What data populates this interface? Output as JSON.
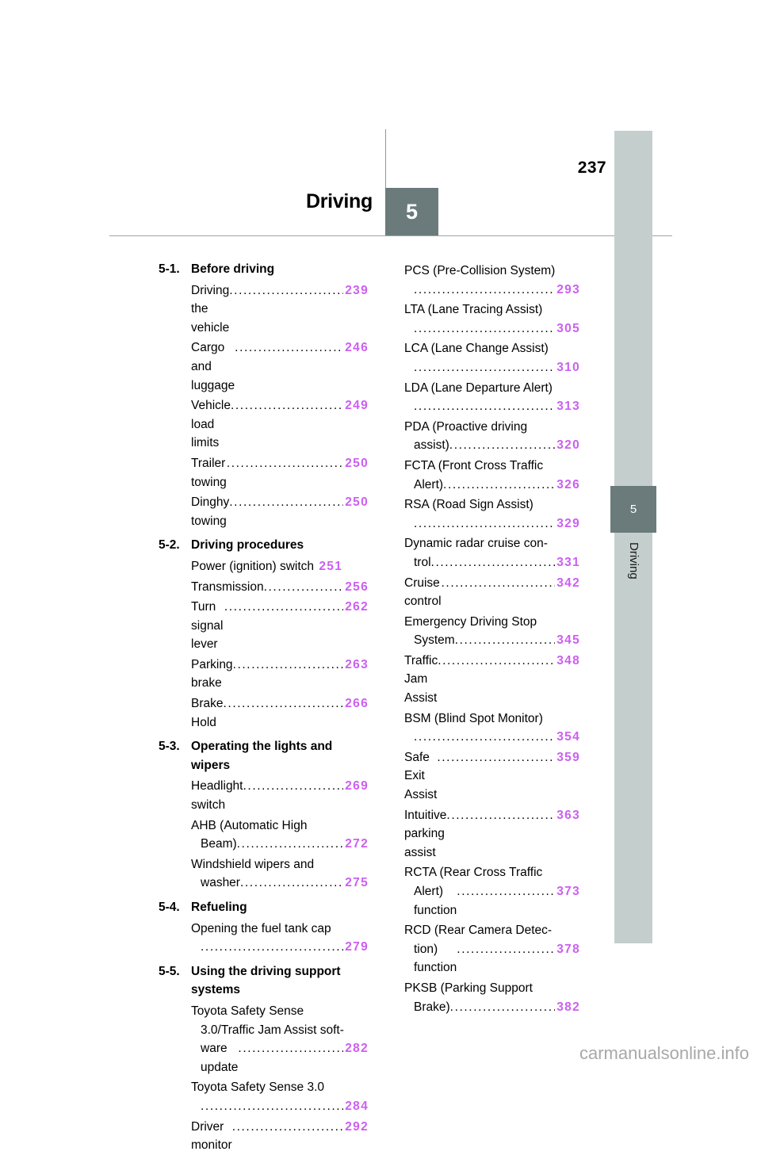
{
  "header": {
    "chapter_title": "Driving",
    "chapter_number": "5",
    "page_number": "237"
  },
  "side_tab": {
    "number": "5",
    "label": "Driving"
  },
  "watermark": "carmanualsonline.info",
  "colors": {
    "page_number_link": "#cc5ff0",
    "chapter_badge": "#6b7b7b",
    "side_tab_strip": "#c4cfcd",
    "rule": "#9aa5a5"
  },
  "toc": {
    "left_column": [
      {
        "type": "section",
        "number": "5-1.",
        "name": "Before driving"
      },
      {
        "type": "entry",
        "lines": [
          "Driving the vehicle"
        ],
        "page": "239"
      },
      {
        "type": "entry",
        "lines": [
          "Cargo and luggage "
        ],
        "page": "246"
      },
      {
        "type": "entry",
        "lines": [
          "Vehicle load limits "
        ],
        "page": "249"
      },
      {
        "type": "entry",
        "lines": [
          "Trailer towing "
        ],
        "page": "250"
      },
      {
        "type": "entry",
        "lines": [
          "Dinghy towing "
        ],
        "page": "250"
      },
      {
        "type": "section",
        "number": "5-2.",
        "name": "Driving procedures"
      },
      {
        "type": "entry",
        "lines": [
          "Power (ignition) switch "
        ],
        "page": "251",
        "no_leader": true
      },
      {
        "type": "entry",
        "lines": [
          "Transmission"
        ],
        "page": "256"
      },
      {
        "type": "entry",
        "lines": [
          "Turn signal lever "
        ],
        "page": "262"
      },
      {
        "type": "entry",
        "lines": [
          "Parking brake"
        ],
        "page": "263"
      },
      {
        "type": "entry",
        "lines": [
          "Brake Hold "
        ],
        "page": "266"
      },
      {
        "type": "section",
        "number": "5-3.",
        "name": "Operating the lights and wipers"
      },
      {
        "type": "entry",
        "lines": [
          "Headlight switch"
        ],
        "page": "269"
      },
      {
        "type": "entry",
        "lines": [
          "AHB (Automatic High",
          "Beam)"
        ],
        "page": "272"
      },
      {
        "type": "entry",
        "lines": [
          "Windshield wipers and",
          "washer"
        ],
        "page": "275"
      },
      {
        "type": "section",
        "number": "5-4.",
        "name": "Refueling"
      },
      {
        "type": "entry",
        "lines": [
          "Opening the fuel tank cap",
          ""
        ],
        "page": "279"
      },
      {
        "type": "section",
        "number": "5-5.",
        "name": "Using the driving support systems"
      },
      {
        "type": "entry",
        "lines": [
          "Toyota Safety Sense",
          "3.0/Traffic Jam Assist soft-",
          "ware update "
        ],
        "page": "282"
      },
      {
        "type": "entry",
        "lines": [
          "Toyota Safety Sense 3.0",
          ""
        ],
        "page": "284"
      },
      {
        "type": "entry",
        "lines": [
          "Driver monitor "
        ],
        "page": "292"
      }
    ],
    "right_column": [
      {
        "type": "entry",
        "lines": [
          "PCS (Pre-Collision System)",
          ""
        ],
        "page": "293"
      },
      {
        "type": "entry",
        "lines": [
          "LTA (Lane Tracing Assist)",
          ""
        ],
        "page": "305"
      },
      {
        "type": "entry",
        "lines": [
          "LCA (Lane Change Assist)",
          ""
        ],
        "page": "310"
      },
      {
        "type": "entry",
        "lines": [
          "LDA (Lane Departure Alert)",
          ""
        ],
        "page": "313"
      },
      {
        "type": "entry",
        "lines": [
          "PDA (Proactive driving",
          "assist)"
        ],
        "page": "320"
      },
      {
        "type": "entry",
        "lines": [
          "FCTA (Front Cross Traffic",
          "Alert)"
        ],
        "page": "326"
      },
      {
        "type": "entry",
        "lines": [
          "RSA (Road Sign Assist)",
          ""
        ],
        "page": "329"
      },
      {
        "type": "entry",
        "lines": [
          "Dynamic radar cruise con-",
          "trol "
        ],
        "page": "331"
      },
      {
        "type": "entry",
        "lines": [
          "Cruise control "
        ],
        "page": "342"
      },
      {
        "type": "entry",
        "lines": [
          "Emergency Driving Stop",
          "System "
        ],
        "page": "345"
      },
      {
        "type": "entry",
        "lines": [
          "Traffic Jam Assist"
        ],
        "page": "348"
      },
      {
        "type": "entry",
        "lines": [
          "BSM (Blind Spot Monitor)",
          ""
        ],
        "page": "354"
      },
      {
        "type": "entry",
        "lines": [
          "Safe Exit Assist "
        ],
        "page": "359"
      },
      {
        "type": "entry",
        "lines": [
          "Intuitive parking assist "
        ],
        "page": "363"
      },
      {
        "type": "entry",
        "lines": [
          "RCTA (Rear Cross Traffic",
          "Alert) function "
        ],
        "page": "373"
      },
      {
        "type": "entry",
        "lines": [
          "RCD (Rear Camera Detec-",
          "tion) function"
        ],
        "page": "378"
      },
      {
        "type": "entry",
        "lines": [
          "PKSB (Parking Support",
          "Brake)"
        ],
        "page": "382"
      }
    ]
  }
}
